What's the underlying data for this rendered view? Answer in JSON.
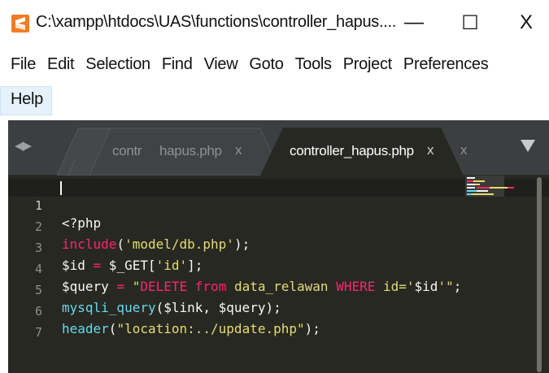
{
  "window": {
    "title": "C:\\xampp\\htdocs\\UAS\\functions\\controller_hapus....",
    "minimize_glyph": "—",
    "maximize_glyph": "☐",
    "close_glyph": "X"
  },
  "menu": {
    "row1": [
      "File",
      "Edit",
      "Selection",
      "Find",
      "View",
      "Goto",
      "Tools",
      "Project",
      "Preferences"
    ],
    "row2": [
      "Help"
    ]
  },
  "tabs": {
    "nav_glyph": "◀▶",
    "partial_label": "contr",
    "items": [
      {
        "label": "hapus.php",
        "close": "x",
        "active": false
      },
      {
        "label": "controller_hapus.php",
        "close": "x",
        "active": true
      }
    ],
    "extra_close": "x"
  },
  "editor": {
    "line_numbers": [
      "1",
      "2",
      "3",
      "4",
      "5",
      "6",
      "7"
    ],
    "lines": [
      [
        {
          "t": "<?php",
          "c": "var"
        }
      ],
      [
        {
          "t": "include",
          "c": "kw"
        },
        {
          "t": "(",
          "c": "var"
        },
        {
          "t": "'model/db.php'",
          "c": "str"
        },
        {
          "t": ");",
          "c": "var"
        }
      ],
      [
        {
          "t": "$id ",
          "c": "var"
        },
        {
          "t": "=",
          "c": "kw"
        },
        {
          "t": " $_GET[",
          "c": "var"
        },
        {
          "t": "'id'",
          "c": "str"
        },
        {
          "t": "];",
          "c": "var"
        }
      ],
      [
        {
          "t": "$query ",
          "c": "var"
        },
        {
          "t": "=",
          "c": "kw"
        },
        {
          "t": " ",
          "c": "var"
        },
        {
          "t": "\"",
          "c": "str"
        },
        {
          "t": "DELETE from",
          "c": "kw"
        },
        {
          "t": " data_relawan ",
          "c": "str"
        },
        {
          "t": "WHERE",
          "c": "kw"
        },
        {
          "t": " id='",
          "c": "str"
        },
        {
          "t": "$id",
          "c": "var"
        },
        {
          "t": "'\"",
          "c": "str"
        },
        {
          "t": ";",
          "c": "var"
        }
      ],
      [
        {
          "t": "mysqli_query",
          "c": "fn"
        },
        {
          "t": "($link, $query);",
          "c": "var"
        }
      ],
      [
        {
          "t": "header",
          "c": "fn"
        },
        {
          "t": "(",
          "c": "var"
        },
        {
          "t": "\"location:../update.php\"",
          "c": "str"
        },
        {
          "t": ");",
          "c": "var"
        }
      ],
      []
    ]
  },
  "colors": {
    "editor_bg": "#272822",
    "tabbar_bg": "#3b3f41",
    "keyword": "#f92672",
    "function": "#66d9ef",
    "string": "#e6db74",
    "text": "#f8f8f2",
    "app_icon": "#f37c22"
  }
}
